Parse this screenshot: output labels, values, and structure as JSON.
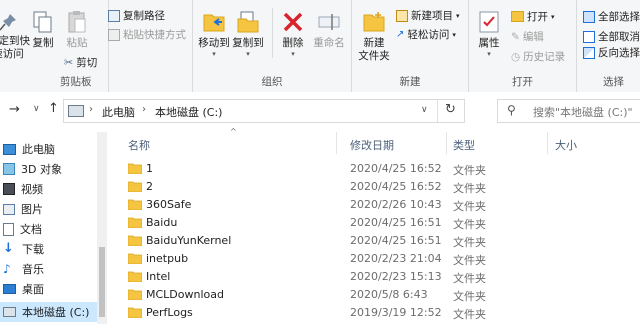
{
  "ribbon": {
    "clipboard": {
      "pin_label": "固定到快\n速访问",
      "copy_label": "复制",
      "paste_label": "粘贴",
      "copy_path": "复制路径",
      "paste_shortcut": "粘贴快捷方式",
      "cut": "剪切",
      "group": "剪贴板"
    },
    "organize": {
      "move_to": "移动到",
      "copy_to": "复制到",
      "delete": "删除",
      "rename": "重命名",
      "group": "组织"
    },
    "new": {
      "new_folder": "新建\n文件夹",
      "new_item": "新建项目",
      "easy_access": "轻松访问",
      "group": "新建"
    },
    "open": {
      "properties": "属性",
      "open": "打开",
      "edit": "编辑",
      "history": "历史记录",
      "group": "打开"
    },
    "select": {
      "select_all": "全部选择",
      "select_none": "全部取消",
      "invert": "反向选择",
      "group": "选择"
    }
  },
  "address": {
    "crumbs": [
      "此电脑",
      "本地磁盘 (C:)"
    ],
    "search_placeholder": "搜索\"本地磁盘 (C:)\""
  },
  "nav": [
    {
      "label": "此电脑",
      "icon": "computer-icon"
    },
    {
      "label": "3D 对象",
      "icon": "3d-objects-icon"
    },
    {
      "label": "视频",
      "icon": "video-icon"
    },
    {
      "label": "图片",
      "icon": "pictures-icon"
    },
    {
      "label": "文档",
      "icon": "documents-icon"
    },
    {
      "label": "下载",
      "icon": "download-icon"
    },
    {
      "label": "音乐",
      "icon": "music-icon"
    },
    {
      "label": "桌面",
      "icon": "desktop-icon"
    },
    {
      "label": "本地磁盘 (C:)",
      "icon": "drive-icon"
    }
  ],
  "columns": {
    "name": "名称",
    "modified": "修改日期",
    "type": "类型",
    "size": "大小"
  },
  "files": [
    {
      "name": "1",
      "modified": "2020/4/25 16:52",
      "type": "文件夹"
    },
    {
      "name": "2",
      "modified": "2020/4/25 16:52",
      "type": "文件夹"
    },
    {
      "name": "360Safe",
      "modified": "2020/2/26 10:43",
      "type": "文件夹"
    },
    {
      "name": "Baidu",
      "modified": "2020/4/25 16:51",
      "type": "文件夹"
    },
    {
      "name": "BaiduYunKernel",
      "modified": "2020/4/25 16:51",
      "type": "文件夹"
    },
    {
      "name": "inetpub",
      "modified": "2020/2/23 21:04",
      "type": "文件夹"
    },
    {
      "name": "Intel",
      "modified": "2020/2/23 15:13",
      "type": "文件夹"
    },
    {
      "name": "MCLDownload",
      "modified": "2020/5/8 6:43",
      "type": "文件夹"
    },
    {
      "name": "PerfLogs",
      "modified": "2019/3/19 12:52",
      "type": "文件夹"
    }
  ]
}
